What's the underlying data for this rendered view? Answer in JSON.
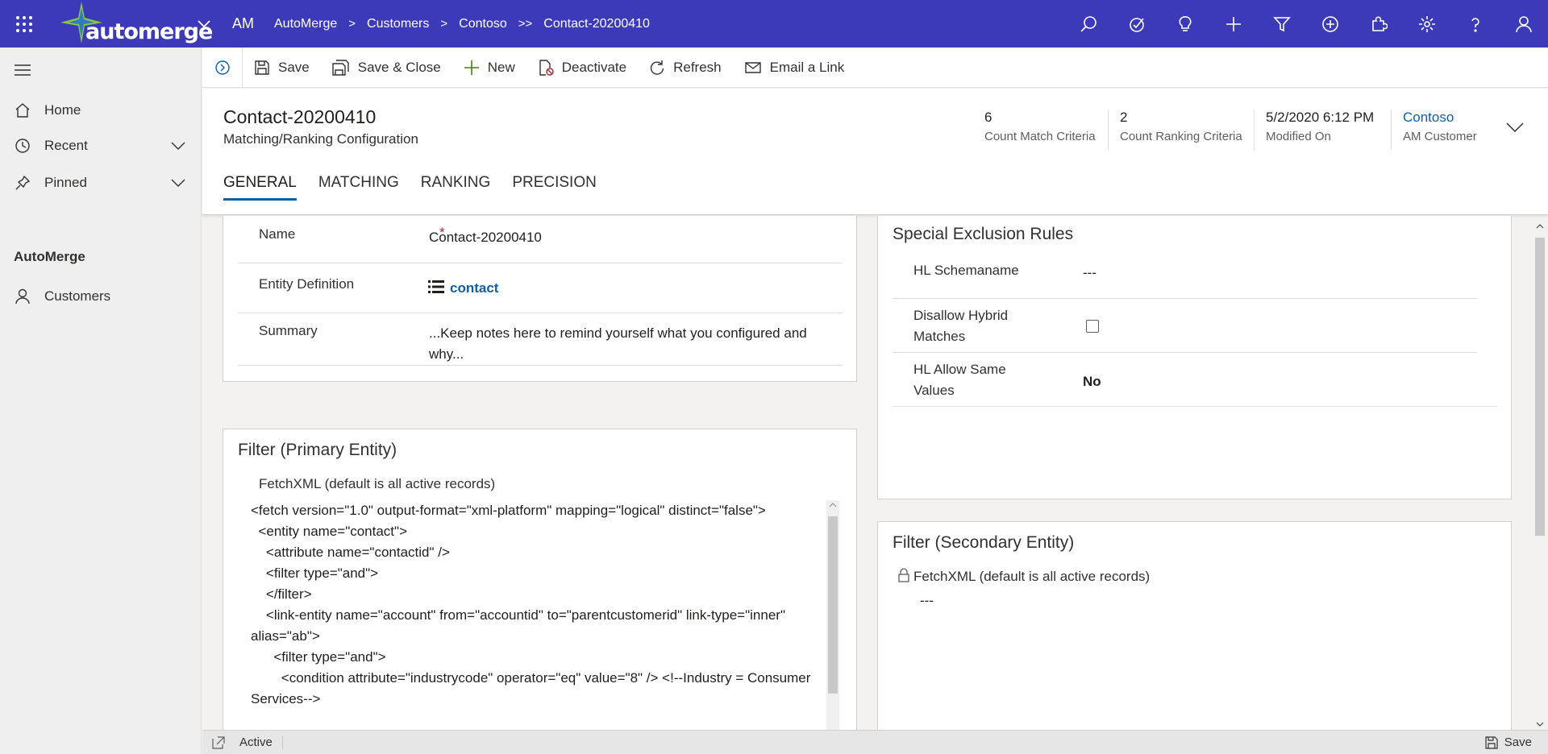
{
  "colors": {
    "topbar": "#3c3ab8",
    "accent": "#115ea3",
    "required": "#a4262c"
  },
  "topbar": {
    "logo_text": "automerge",
    "app_abbr": "AM",
    "breadcrumbs": [
      "AutoMerge",
      "Customers",
      "Contoso",
      "Contact-20200410"
    ],
    "breadcrumb_seps": [
      ">",
      ">",
      ">>"
    ],
    "icons": [
      "search-icon",
      "task-icon",
      "lightbulb-icon",
      "plus-icon",
      "filter-icon",
      "add-circle-icon",
      "puzzle-icon",
      "settings-icon",
      "help-icon",
      "user-icon"
    ]
  },
  "sidebar": {
    "items": [
      {
        "label": "Home",
        "icon": "home-icon"
      },
      {
        "label": "Recent",
        "icon": "clock-icon"
      },
      {
        "label": "Pinned",
        "icon": "pin-icon"
      }
    ],
    "group_label": "AutoMerge",
    "group_items": [
      {
        "label": "Customers",
        "icon": "person-icon"
      }
    ]
  },
  "commands": [
    {
      "label": "Save",
      "icon": "save-icon"
    },
    {
      "label": "Save & Close",
      "icon": "save-close-icon"
    },
    {
      "label": "New",
      "icon": "plus-icon"
    },
    {
      "label": "Deactivate",
      "icon": "deactivate-icon"
    },
    {
      "label": "Refresh",
      "icon": "refresh-icon"
    },
    {
      "label": "Email a Link",
      "icon": "email-icon"
    }
  ],
  "header": {
    "title": "Contact-20200410",
    "subtitle": "Matching/Ranking Configuration",
    "fields": [
      {
        "value": "6",
        "label": "Count Match Criteria"
      },
      {
        "value": "2",
        "label": "Count Ranking Criteria"
      },
      {
        "value": "5/2/2020 6:12 PM",
        "label": "Modified On"
      },
      {
        "value": "Contoso",
        "label": "AM Customer"
      }
    ],
    "tabs": [
      "GENERAL",
      "MATCHING",
      "RANKING",
      "PRECISION"
    ],
    "active_tab": "GENERAL"
  },
  "general": {
    "name_label": "Name",
    "required_mark": "*",
    "name_value": "Contact-20200410",
    "entity_label": "Entity Definition",
    "entity_value": "contact",
    "summary_label": "Summary",
    "summary_value": "...Keep notes here to remind yourself what you configured and why..."
  },
  "filter_primary": {
    "title": "Filter (Primary Entity)",
    "field_label": "FetchXML (default is all active records)",
    "code": "<fetch version=\"1.0\" output-format=\"xml-platform\" mapping=\"logical\" distinct=\"false\">\n  <entity name=\"contact\">\n    <attribute name=\"contactid\" />\n    <filter type=\"and\">\n    </filter>\n    <link-entity name=\"account\" from=\"accountid\" to=\"parentcustomerid\" link-type=\"inner\" alias=\"ab\">\n      <filter type=\"and\">\n        <condition attribute=\"industrycode\" operator=\"eq\" value=\"8\" /> <!--Industry = Consumer Services-->"
  },
  "exclusion": {
    "title": "Special Exclusion Rules",
    "hl_schemaname_label": "HL Schemaname",
    "hl_schemaname_value": "---",
    "disallow_label": "Disallow Hybrid Matches",
    "disallow_checked": false,
    "allow_same_label": "HL Allow Same Values",
    "allow_same_value": "No"
  },
  "filter_secondary": {
    "title": "Filter (Secondary Entity)",
    "field_label": "FetchXML (default is all active records)",
    "value": "---"
  },
  "footer": {
    "status": "Active",
    "save_label": "Save"
  }
}
